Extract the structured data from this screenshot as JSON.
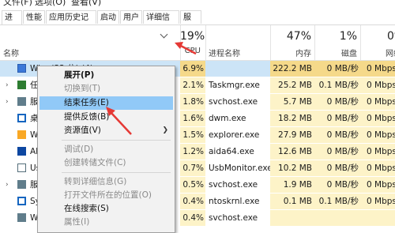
{
  "menubar": {
    "file": "文件(F)",
    "options": "选项(O)",
    "view": "查看(V)"
  },
  "tabs": [
    "进程",
    "性能",
    "应用历史记录",
    "启动",
    "用户",
    "详细信息",
    "服务"
  ],
  "header": {
    "name": "名称",
    "cpu_pct": "19%",
    "cpu": "CPU",
    "proc": "进程名称",
    "mem_pct": "47%",
    "mem": "内存",
    "disk_pct": "1%",
    "disk": "磁盘",
    "net_pct": "0%",
    "net": "网络"
  },
  "rows": [
    {
      "expand": "",
      "name": "Wi... (32 位) (4)",
      "cpu": "6.9%",
      "proc": "",
      "mem": "222.2 MB",
      "disk": "0 MB/秒",
      "net": "0 Mbps",
      "icon": "#3c78d8"
    },
    {
      "expand": "›",
      "name": "任务",
      "cpu": "2.1%",
      "proc": "Taskmgr.exe",
      "mem": "25.2 MB",
      "disk": "0.1 MB/秒",
      "net": "0 Mbps",
      "icon": "#2e7d32"
    },
    {
      "expand": "›",
      "name": "服务",
      "cpu": "1.8%",
      "proc": "svchost.exe",
      "mem": "5.7 MB",
      "disk": "0 MB/秒",
      "net": "0 Mbps",
      "icon": "#607d8b"
    },
    {
      "expand": "",
      "name": "桌面",
      "cpu": "1.6%",
      "proc": "dwm.exe",
      "mem": "18.2 MB",
      "disk": "0 MB/秒",
      "net": "0 Mbps",
      "icon": "#1565c0"
    },
    {
      "expand": "",
      "name": "Win",
      "cpu": "1.5%",
      "proc": "explorer.exe",
      "mem": "27.9 MB",
      "disk": "0 MB/秒",
      "net": "0 Mbps",
      "icon": "#f9a825"
    },
    {
      "expand": "",
      "name": "AID",
      "cpu": "1.2%",
      "proc": "aida64.exe",
      "mem": "12.6 MB",
      "disk": "0 MB/秒",
      "net": "0 Mbps",
      "icon": "#0d47a1"
    },
    {
      "expand": "",
      "name": "Usb",
      "cpu": "0.7%",
      "proc": "UsbMonitor.exe",
      "mem": "10.2 MB",
      "disk": "0 MB/秒",
      "net": "0 Mbps",
      "icon": "#546e7a"
    },
    {
      "expand": "›",
      "name": "服务",
      "cpu": "0.5%",
      "proc": "svchost.exe",
      "mem": "1.9 MB",
      "disk": "0 MB/秒",
      "net": "0 Mbps",
      "icon": "#607d8b"
    },
    {
      "expand": "",
      "name": "Sys",
      "cpu": "0.4%",
      "proc": "ntoskrnl.exe",
      "mem": "0.1 MB",
      "disk": "0.1 MB/秒",
      "net": "0 Mbps",
      "icon": "#1565c0"
    },
    {
      "expand": "",
      "name": "Wi",
      "cpu": "0.4%",
      "proc": "svchost.exe",
      "mem": "",
      "disk": "",
      "net": "",
      "icon": "#607d8b"
    }
  ],
  "context_menu": {
    "expand": "展开(P)",
    "switch_to": "切换到(T)",
    "end_task": "结束任务(E)",
    "feedback": "提供反馈(B)",
    "resource_values": "资源值(V)",
    "debug": "调试(D)",
    "create_dump": "创建转储文件(C)",
    "goto_details": "转到详细信息(G)",
    "open_location": "打开文件所在的位置(O)",
    "search_online": "在线搜索(S)",
    "properties": "属性(I)"
  },
  "colors": {
    "heat": "#fdf3c8",
    "selected_row": "#cce4f7",
    "menu_highlight": "#91c9f7",
    "annotation_arrow": "#e53935"
  }
}
